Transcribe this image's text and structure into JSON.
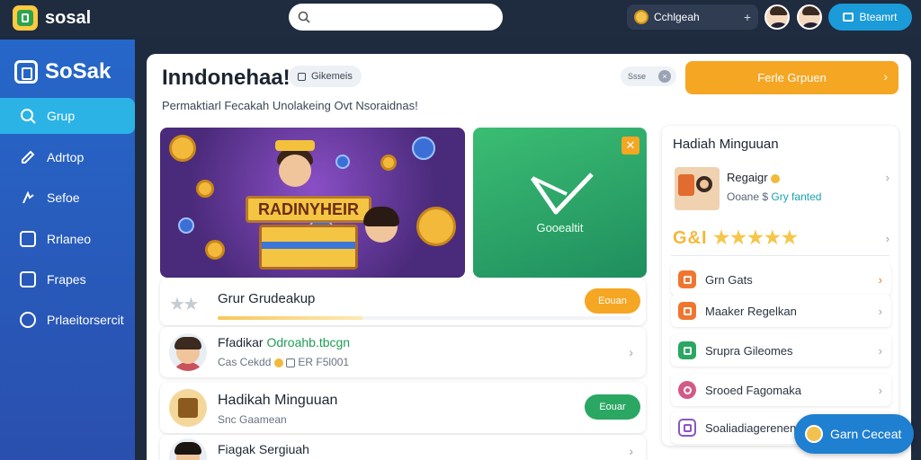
{
  "topbar": {
    "brand": "sosal",
    "search_placeholder": "",
    "account_label": "Cchlgeah",
    "account_plus": "+",
    "action_button": "Bteamrt"
  },
  "sidebar": {
    "brand": "SoSak",
    "items": [
      {
        "label": "Grup",
        "icon": "search-icon",
        "active": true
      },
      {
        "label": "Adrtop",
        "icon": "edit-icon",
        "active": false
      },
      {
        "label": "Sefoe",
        "icon": "settings-icon",
        "active": false
      },
      {
        "label": "Rrlaneo",
        "icon": "list-icon",
        "active": false
      },
      {
        "label": "Frapes",
        "icon": "image-icon",
        "active": false
      },
      {
        "label": "Prlaeitorsercit",
        "icon": "rupiah-icon",
        "active": false
      }
    ]
  },
  "header": {
    "title": "Inndonehaa!",
    "category_chip": "Gikemeis",
    "subtitle": "Permaktiarl Fecakah Unolakeing  Ovt Nsoraidnas!",
    "mini_pill": "Ssse",
    "cta_label": "Ferle Grpuen"
  },
  "banner": {
    "main_sign": "RADINYHEIR",
    "green_caption": "Gooealtit"
  },
  "rows": [
    {
      "kind": "progress",
      "title": "Grur Grudeakup",
      "button": "Eouan",
      "progress": 0.35
    },
    {
      "kind": "user",
      "title": "Ffadikar",
      "title_highlight": "Odroahb.tbcgn",
      "sub": "Cas Cekdd",
      "sub_extra": "ER F5l001"
    },
    {
      "kind": "reward",
      "title": "Hadikah Minguuan",
      "sub": "Snc Gaamean",
      "button": "Eouar"
    },
    {
      "kind": "user",
      "title": "Fiagak Sergiuah",
      "sub": ""
    }
  ],
  "right_panel": {
    "title": "Hadiah Minguuan",
    "featured": {
      "name": "Regaigr",
      "sub_left": "Ooane $",
      "sub_highlight": "Gry fanted"
    },
    "rating_label": "G&I",
    "rating_stars": "★★★★★",
    "rating_value": 5,
    "items": [
      {
        "label": "Grn Gats",
        "color": "#f0752f",
        "chevron_color": "orange"
      },
      {
        "label": "Maaker Regelkan",
        "color": "#f0752f",
        "chevron_color": "gray"
      },
      {
        "label": "Srupra Gileomes",
        "color": "#2aa762",
        "chevron_color": "gray"
      },
      {
        "label": "Srooed Fagomaka",
        "color": "#d25a86",
        "chevron_color": "gray"
      },
      {
        "label": "Soaliadiagerenen",
        "color": "#8a55c6",
        "chevron_color": "gray"
      }
    ]
  },
  "chat_button": "Garn Ceceat",
  "colors": {
    "accent_orange": "#f5a623",
    "accent_blue": "#2bb3e6",
    "sidebar_blue": "#2667c9",
    "green": "#2aa762"
  }
}
